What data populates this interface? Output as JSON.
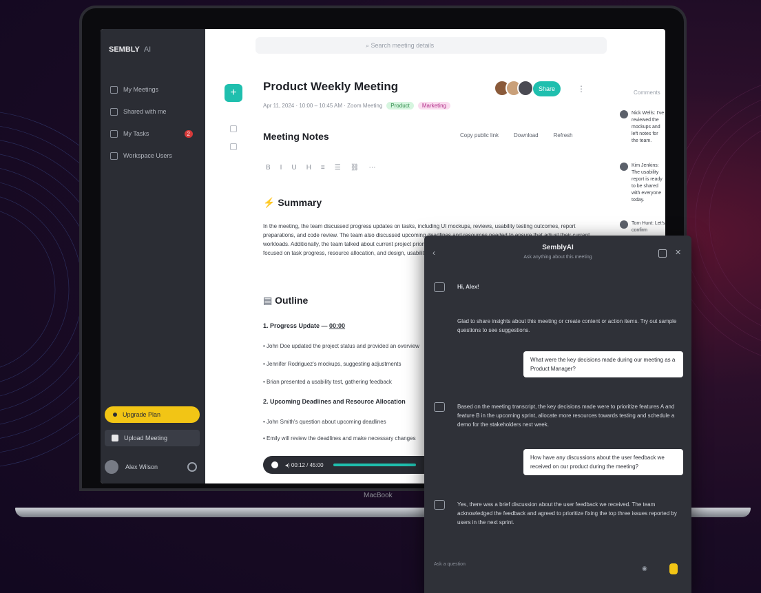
{
  "device_label": "MacBook",
  "sidebar": {
    "logo": "SEMBLY",
    "logo_tag": "AI",
    "items": [
      {
        "label": "My Meetings",
        "icon": "calendar-icon"
      },
      {
        "label": "Shared with me",
        "icon": "share-icon"
      },
      {
        "label": "My Tasks",
        "icon": "task-icon",
        "badge": "2"
      },
      {
        "label": "Workspace Users",
        "icon": "users-icon"
      }
    ],
    "upgrade_label": "Upgrade Plan",
    "schedule_label": "Upload Meeting",
    "user_name": "Alex Wilson"
  },
  "search_placeholder": "Search meeting details",
  "meeting": {
    "title": "Product Weekly Meeting",
    "meta": "Apr 11, 2024 · 10:00 – 10:45 AM · Zoom Meeting",
    "tag1": "Product",
    "tag2": "Marketing",
    "share_label": "Share"
  },
  "notes": {
    "heading": "Meeting Notes",
    "actions": [
      "Copy public link",
      "Download",
      "Refresh"
    ],
    "toolbar": [
      "B",
      "I",
      "U",
      "H",
      "≡",
      "☰",
      "⛓",
      "⋯"
    ]
  },
  "summary": {
    "heading": "Summary",
    "text": "In the meeting, the team discussed progress updates on tasks, including UI mockups, reviews, usability testing outcomes, report preparations, and code review. The team also discussed upcoming deadlines and resources needed to ensure that adjust their current workloads. Additionally, the team talked about current project priorities and allocation for a new wiring project. Overall, the meeting focused on task progress, resource allocation, and design, usability and timely delivery."
  },
  "outline": {
    "heading": "Outline",
    "sections": [
      {
        "title": "1. Progress Update",
        "time": "00:00",
        "bullets": [
          "John Doe updated the project status and provided an overview",
          "Jennifer Rodriguez's mockups, suggesting adjustments",
          "Brian presented a usability test, gathering feedback"
        ]
      },
      {
        "title": "2. Upcoming Deadlines and Resource Allocation",
        "bullets": [
          "John Smith's question about upcoming deadlines",
          "Emily will review the deadlines and make necessary changes"
        ]
      }
    ]
  },
  "player": {
    "time": "00:12 / 45:00"
  },
  "comments": {
    "header": "Comments",
    "items": [
      "Nick Wells: I've reviewed the mockups and left notes for the team.",
      "Kim Jenkins: The usability report is ready to be shared with everyone today.",
      "Tom Hunt: Let's confirm resources"
    ]
  },
  "chat": {
    "title": "SemblyAI",
    "subtitle": "Ask anything about this meeting",
    "greeting": "Hi, Alex!",
    "intro": "Glad to share insights about this meeting or create content or action items. Try out sample questions to see suggestions.",
    "messages": [
      {
        "role": "user",
        "text": "What were the key decisions made during our meeting as a Product Manager?"
      },
      {
        "role": "bot",
        "text": "Based on the meeting transcript, the key decisions made were to prioritize features A and feature B in the upcoming sprint, allocate more resources towards testing and schedule a demo for the stakeholders next week."
      },
      {
        "role": "user",
        "text": "How have any discussions about the user feedback we received on our product during the meeting?"
      },
      {
        "role": "bot",
        "text": "Yes, there was a brief discussion about the user feedback we received. The team acknowledged the feedback and agreed to prioritize fixing the top three issues reported by users in the next sprint."
      }
    ],
    "input_placeholder": "Ask a question",
    "send_icon": "send-icon"
  }
}
